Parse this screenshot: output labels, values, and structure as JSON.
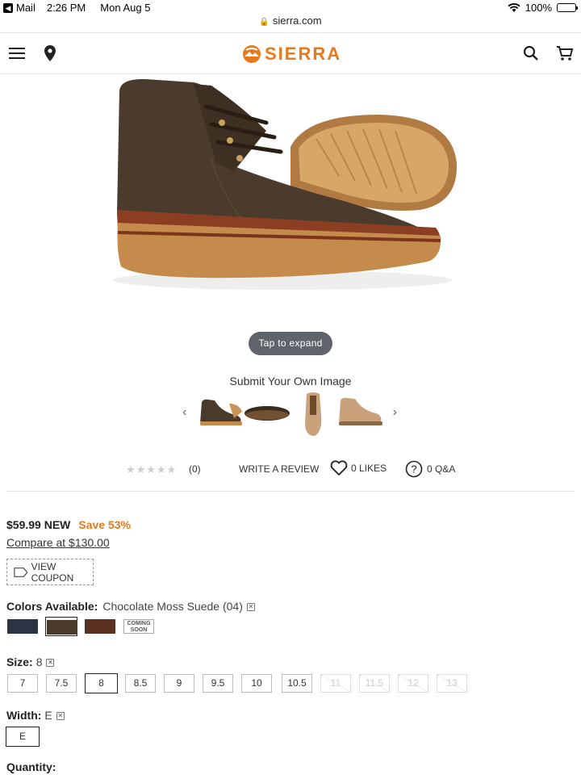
{
  "status_bar": {
    "app": "Mail",
    "time": "2:26 PM",
    "date": "Mon Aug 5",
    "battery": "100%"
  },
  "url": "sierra.com",
  "header": {
    "brand": "SIERRA",
    "brand_color": "#e8791c"
  },
  "gallery": {
    "expand_label": "Tap to expand",
    "submit_image_label": "Submit Your Own Image"
  },
  "rating": {
    "stars": "★★★★★",
    "count": "(0)",
    "write_review": "WRITE A REVIEW",
    "likes": "0 LIKES",
    "qa": "0 Q&A"
  },
  "pricing": {
    "price": "$59.99 NEW",
    "save": "Save 53%",
    "compare": "Compare at $130.00",
    "coupon_label": "VIEW COUPON"
  },
  "colors": {
    "label": "Colors Available:",
    "selected": "Chocolate Moss Suede (04)",
    "swatches": [
      {
        "color": "#2c3443"
      },
      {
        "color": "#4a3a2a"
      },
      {
        "color": "#5b3121"
      },
      {
        "text": "COMING SOON"
      }
    ]
  },
  "size": {
    "label": "Size:",
    "selected": "8",
    "options": [
      "7",
      "7.5",
      "8",
      "8.5",
      "9",
      "9.5",
      "10",
      "10.5",
      "11",
      "11.5",
      "12",
      "13"
    ]
  },
  "width": {
    "label": "Width:",
    "selected": "E",
    "option": "E"
  },
  "quantity": {
    "label": "Quantity:"
  }
}
